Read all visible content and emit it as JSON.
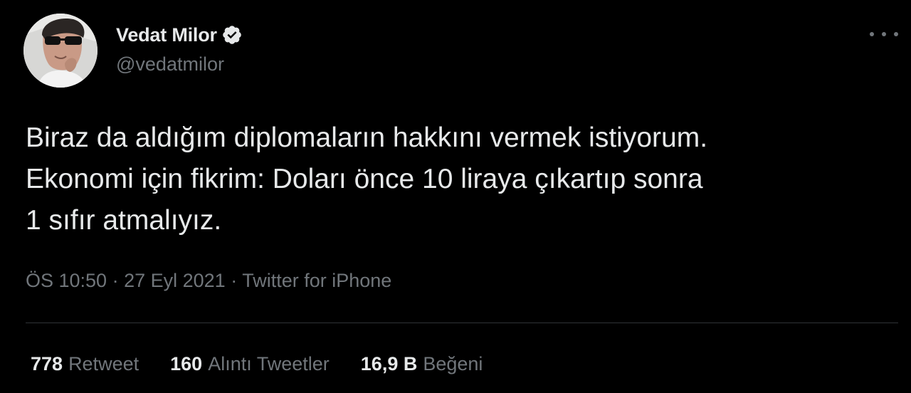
{
  "author": {
    "display_name": "Vedat Milor",
    "handle": "@vedatmilor",
    "verified": true,
    "avatar_icon": "profile-photo"
  },
  "tweet": {
    "lines": [
      "Biraz da aldığım diplomaların hakkını vermek istiyorum.",
      "Ekonomi için fikrim: Doları önce 10 liraya çıkartıp sonra",
      "1 sıfır atmalıyız."
    ]
  },
  "meta": {
    "time": "ÖS 10:50",
    "separator": " · ",
    "date": "27 Eyl 2021",
    "source": "Twitter for iPhone"
  },
  "stats": {
    "retweets": {
      "count": "778",
      "label": "Retweet"
    },
    "quotes": {
      "count": "160",
      "label": "Alıntı Tweetler"
    },
    "likes": {
      "count": "16,9 B",
      "label": "Beğeni"
    }
  },
  "icons": {
    "more": "more-options-icon",
    "verified": "verified-badge-icon"
  },
  "colors": {
    "background": "#000000",
    "text_primary": "#e7e9ea",
    "text_secondary": "#71767b",
    "divider": "#2f3336"
  }
}
